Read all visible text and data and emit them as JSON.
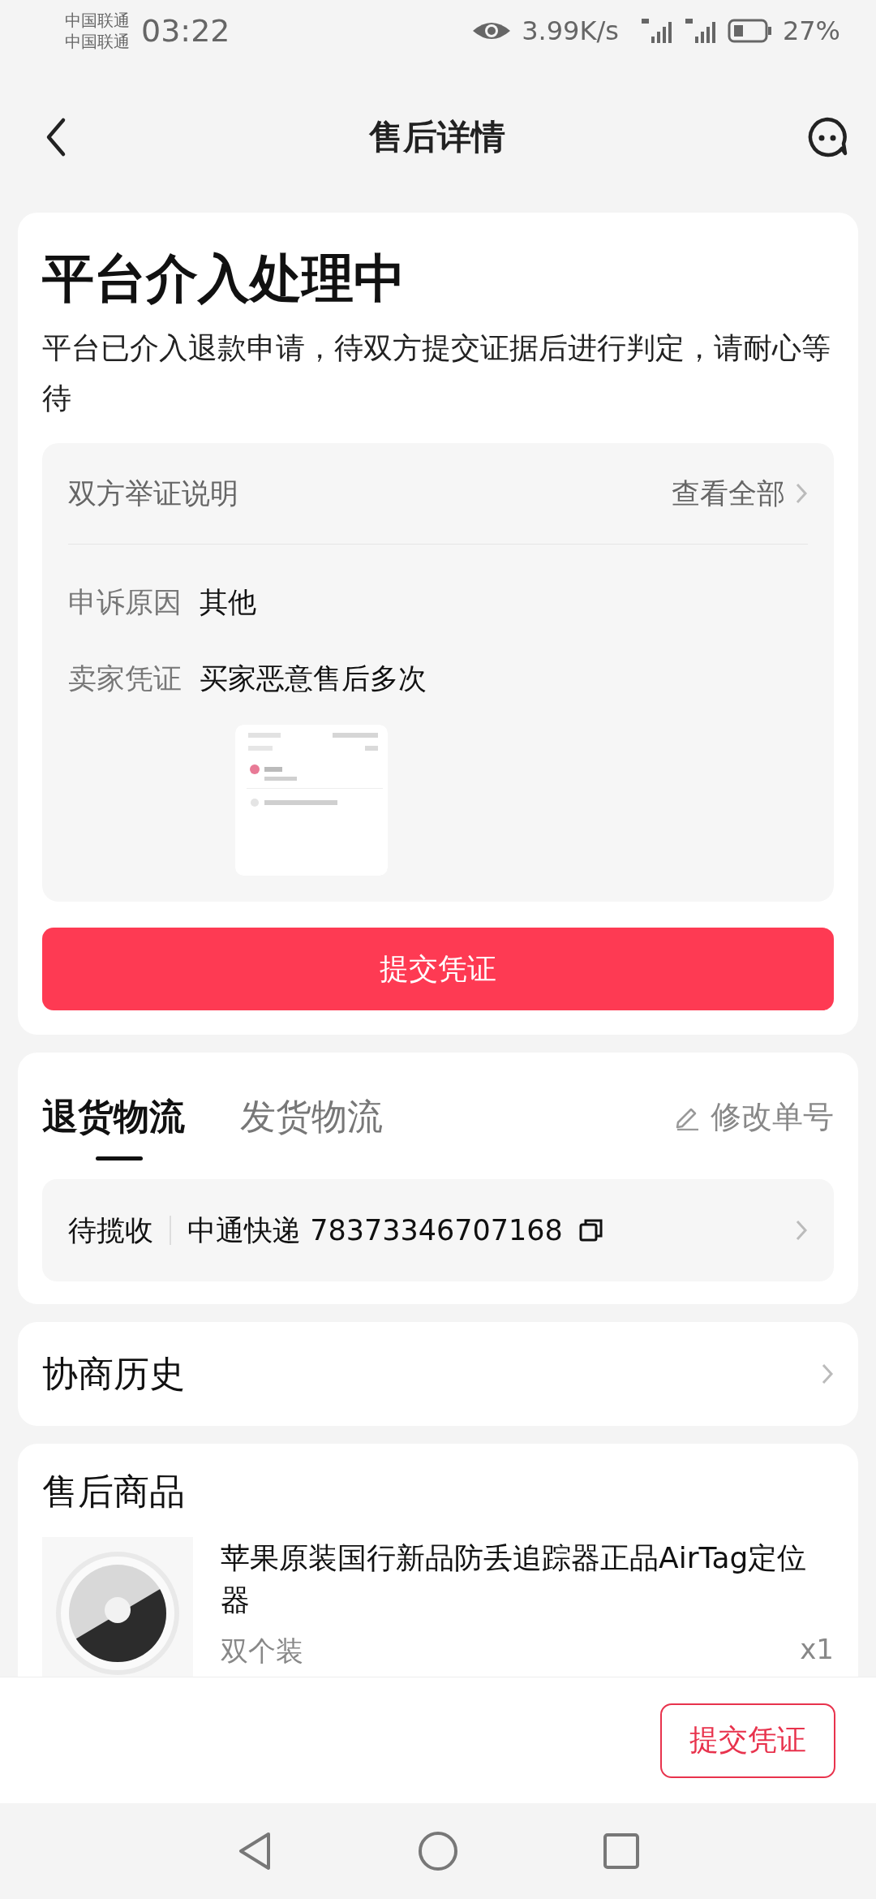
{
  "status_bar": {
    "carriers": [
      "中国联通",
      "中国联通"
    ],
    "time": "03:22",
    "speed": "3.99K/s",
    "battery": "27%"
  },
  "header": {
    "title": "售后详情"
  },
  "status_card": {
    "title": "平台介入处理中",
    "description": "平台已介入退款申请，待双方提交证据后进行判定，请耐心等待",
    "evidence": {
      "title": "双方举证说明",
      "link": "查看全部",
      "rows": [
        {
          "label": "申诉原因",
          "value": "其他"
        },
        {
          "label": "卖家凭证",
          "value": "买家恶意售后多次"
        }
      ]
    },
    "button": "提交凭证"
  },
  "logistics": {
    "tabs": [
      {
        "label": "退货物流",
        "selected": true
      },
      {
        "label": "发货物流",
        "selected": false
      }
    ],
    "edit_link": "修改单号",
    "status": "待揽收",
    "carrier": "中通快递 78373346707168"
  },
  "history": {
    "title": "协商历史"
  },
  "product_section": {
    "title": "售后商品",
    "product": {
      "name": "苹果原装国行新品防丢追踪器正品AirTag定位器",
      "variant": "双个装",
      "quantity": "x1"
    }
  },
  "bottom_bar": {
    "button": "提交凭证"
  }
}
